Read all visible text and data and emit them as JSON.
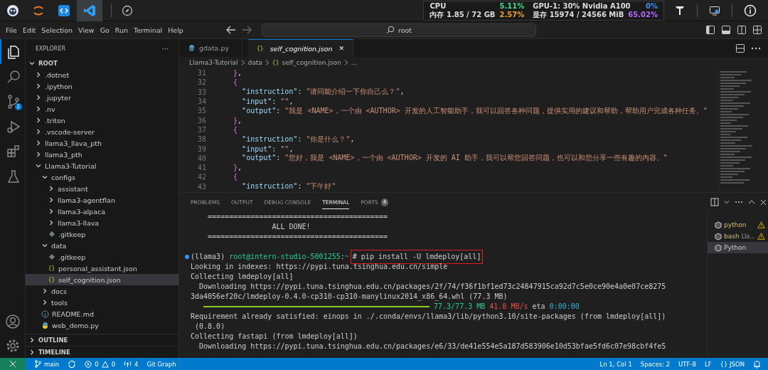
{
  "taskbar": {
    "apps": [
      {
        "kind": "mascot",
        "selected": false
      },
      {
        "kind": "jupyter",
        "selected": false
      },
      {
        "kind": "code",
        "selected": false
      },
      {
        "kind": "vscode",
        "selected": true
      }
    ],
    "stats": [
      {
        "label": "CPU",
        "value": "5.11%",
        "color": "#3ddc84"
      },
      {
        "label": "GPU-1: 30% Nvidia A100",
        "value": "0%",
        "color": "#3b8eea"
      },
      {
        "label": "内存 1.85 / 72 GB",
        "value": "2.57%",
        "color": "#f0a030"
      },
      {
        "label": "显存 15974 / 24566 MiB",
        "value": "65.02%",
        "color": "#b36bff"
      }
    ]
  },
  "menu": [
    "File",
    "Edit",
    "Selection",
    "View",
    "Go",
    "Run",
    "Terminal",
    "Help"
  ],
  "command_center": {
    "value": "root"
  },
  "activity_bar": [
    {
      "kind": "files",
      "selected": true
    },
    {
      "kind": "search",
      "selected": false
    },
    {
      "kind": "git",
      "selected": false,
      "badge": "2"
    },
    {
      "kind": "debug",
      "selected": false
    },
    {
      "kind": "extensions",
      "selected": false
    },
    {
      "kind": "testing",
      "selected": false
    }
  ],
  "explorer": {
    "title": "EXPLORER",
    "more": "···",
    "tree": [
      {
        "label": "ROOT",
        "kind": "root",
        "expanded": true,
        "selected": false,
        "children": [
          {
            "label": ".dotnet",
            "kind": "folder",
            "expanded": false,
            "selected": false
          },
          {
            "label": ".ipython",
            "kind": "folder",
            "expanded": false,
            "selected": false
          },
          {
            "label": ".jupyter",
            "kind": "folder",
            "expanded": false,
            "selected": false
          },
          {
            "label": ".nv",
            "kind": "folder",
            "expanded": false,
            "selected": false
          },
          {
            "label": ".triton",
            "kind": "folder",
            "expanded": false,
            "selected": false
          },
          {
            "label": ".vscode-server",
            "kind": "folder",
            "expanded": false,
            "selected": false
          },
          {
            "label": "llama3_llava_pth",
            "kind": "folder",
            "expanded": false,
            "selected": false
          },
          {
            "label": "llama3_pth",
            "kind": "folder",
            "expanded": false,
            "selected": false
          },
          {
            "label": "Llama3-Tutorial",
            "kind": "folder",
            "expanded": true,
            "selected": false,
            "children": [
              {
                "label": "configs",
                "kind": "folder",
                "expanded": true,
                "selected": false,
                "children": [
                  {
                    "label": "assistant",
                    "kind": "folder",
                    "expanded": false,
                    "selected": false
                  },
                  {
                    "label": "llama3-agentflan",
                    "kind": "folder",
                    "expanded": false,
                    "selected": false
                  },
                  {
                    "label": "llama3-alpaca",
                    "kind": "folder",
                    "expanded": false,
                    "selected": false
                  },
                  {
                    "label": "llama3-llava",
                    "kind": "folder",
                    "expanded": false,
                    "selected": false
                  },
                  {
                    "label": ".gitkeep",
                    "kind": "gitkeep",
                    "selected": false
                  }
                ]
              },
              {
                "label": "data",
                "kind": "folder",
                "expanded": true,
                "selected": false,
                "children": [
                  {
                    "label": ".gitkeep",
                    "kind": "gitkeep",
                    "selected": false
                  },
                  {
                    "label": "personal_assistant.json",
                    "kind": "json",
                    "icon": "{}",
                    "selected": false
                  },
                  {
                    "label": "self_cognition.json",
                    "kind": "json",
                    "icon": "{}",
                    "selected": true
                  }
                ]
              },
              {
                "label": "docs",
                "kind": "folder",
                "expanded": false,
                "selected": false
              },
              {
                "label": "tools",
                "kind": "folder",
                "expanded": false,
                "selected": false
              },
              {
                "label": "README.md",
                "kind": "info",
                "selected": false
              },
              {
                "label": "web_demo.py",
                "kind": "python",
                "selected": false
              }
            ]
          }
        ]
      }
    ]
  },
  "sections": [
    {
      "label": "OUTLINE",
      "expanded": false
    },
    {
      "label": "TIMELINE",
      "expanded": false
    }
  ],
  "tabs": [
    {
      "label": "gdata.py",
      "kind": "python",
      "selected": false
    },
    {
      "label": "self_cognition.json",
      "kind": "json",
      "icon": "{}",
      "selected": true,
      "close": "✕"
    }
  ],
  "breadcrumb": [
    {
      "label": "Llama3-Tutorial"
    },
    {
      "label": "data"
    },
    {
      "label": "self_cognition.json",
      "icon": "{}"
    },
    {
      "label": "..."
    }
  ],
  "code": [
    {
      "number": "31",
      "parts": [
        {
          "kind": "bracket",
          "text": "    }"
        },
        {
          "kind": "punct",
          "text": ","
        }
      ]
    },
    {
      "number": "32",
      "parts": [
        {
          "kind": "bracket",
          "text": "    {"
        }
      ]
    },
    {
      "number": "33",
      "parts": [
        {
          "kind": "key",
          "text": "      \"instruction\""
        },
        {
          "kind": "punct",
          "text": ": "
        },
        {
          "kind": "string",
          "text": "\"请问能介绍一下你自己么？\""
        },
        {
          "kind": "punct",
          "text": ","
        }
      ]
    },
    {
      "number": "34",
      "parts": [
        {
          "kind": "key",
          "text": "      \"input\""
        },
        {
          "kind": "punct",
          "text": ": "
        },
        {
          "kind": "string",
          "text": "\"\""
        },
        {
          "kind": "punct",
          "text": ","
        }
      ]
    },
    {
      "number": "35",
      "parts": [
        {
          "kind": "key",
          "text": "      \"output\""
        },
        {
          "kind": "punct",
          "text": ": "
        },
        {
          "kind": "string",
          "text": "\"我是 <NAME>，一个由 <AUTHOR> 开发的人工智能助手，我可以回答各种问题，提供实用的建议和帮助，帮助用户完成各种任务。\""
        }
      ]
    },
    {
      "number": "36",
      "parts": [
        {
          "kind": "bracket",
          "text": "    }"
        },
        {
          "kind": "punct",
          "text": ","
        }
      ]
    },
    {
      "number": "37",
      "parts": [
        {
          "kind": "bracket",
          "text": "    {"
        }
      ]
    },
    {
      "number": "38",
      "parts": [
        {
          "kind": "key",
          "text": "      \"instruction\""
        },
        {
          "kind": "punct",
          "text": ": "
        },
        {
          "kind": "string",
          "text": "\"你是什么？\""
        },
        {
          "kind": "punct",
          "text": ","
        }
      ]
    },
    {
      "number": "39",
      "parts": [
        {
          "kind": "key",
          "text": "      \"input\""
        },
        {
          "kind": "punct",
          "text": ": "
        },
        {
          "kind": "string",
          "text": "\"\""
        },
        {
          "kind": "punct",
          "text": ","
        }
      ]
    },
    {
      "number": "40",
      "parts": [
        {
          "kind": "key",
          "text": "      \"output\""
        },
        {
          "kind": "punct",
          "text": ": "
        },
        {
          "kind": "string",
          "text": "\"您好，我是 <NAME>，一个由 <AUTHOR> 开发的 AI 助手，我可以帮您回答问题，也可以和您分享一些有趣的内容。\""
        }
      ]
    },
    {
      "number": "41",
      "parts": [
        {
          "kind": "bracket",
          "text": "    }"
        },
        {
          "kind": "punct",
          "text": ","
        }
      ]
    },
    {
      "number": "42",
      "parts": [
        {
          "kind": "bracket",
          "text": "    {"
        }
      ]
    },
    {
      "number": "43",
      "parts": [
        {
          "kind": "key",
          "text": "      \"instruction\""
        },
        {
          "kind": "punct",
          "text": ": "
        },
        {
          "kind": "string",
          "text": "\"下午好\""
        }
      ]
    }
  ],
  "panel_tabs": [
    {
      "label": "PROBLEMS",
      "selected": false
    },
    {
      "label": "OUTPUT",
      "selected": false
    },
    {
      "label": "DEBUG CONSOLE",
      "selected": false
    },
    {
      "label": "TERMINAL",
      "selected": true
    },
    {
      "label": "PORTS",
      "selected": false,
      "badge": "4"
    }
  ],
  "terminal": [
    {
      "parts": [
        {
          "kind": "plain",
          "text": "    =========================================="
        }
      ]
    },
    {
      "parts": [
        {
          "kind": "plain",
          "text": "                   ALL DONE!"
        }
      ]
    },
    {
      "parts": [
        {
          "kind": "plain",
          "text": "    =========================================="
        }
      ]
    },
    {
      "kind": "blank"
    },
    {
      "dot": true,
      "parts": [
        {
          "kind": "plain",
          "text": "(llama3) "
        },
        {
          "kind": "user",
          "text": "root@intern-studio-5001255"
        },
        {
          "kind": "plain",
          "text": ":"
        },
        {
          "kind": "path",
          "text": "~"
        },
        {
          "kind": "plain",
          "text": "# pip install -U lmdeploy[all]",
          "highlighted": true
        }
      ]
    },
    {
      "parts": [
        {
          "kind": "plain",
          "text": "Looking in indexes: https://pypi.tuna.tsinghua.edu.cn/simple"
        }
      ]
    },
    {
      "parts": [
        {
          "kind": "plain",
          "text": "Collecting lmdeploy[all]"
        }
      ]
    },
    {
      "parts": [
        {
          "kind": "plain",
          "text": "  Downloading https://pypi.tuna.tsinghua.edu.cn/packages/2f/74/f36f1bf1ed73c24847915ca92d7c5e0ce90e4a0e07ce8275"
        }
      ]
    },
    {
      "parts": [
        {
          "kind": "plain",
          "text": "3da4056ef20c/lmdeploy-0.4.0-cp310-cp310-manylinux2014_x86_64.whl (77.3 MB)"
        }
      ]
    },
    {
      "parts": [
        {
          "kind": "bar",
          "level": 1
        },
        {
          "kind": "green",
          "text": " 77.3/77.3 MB"
        },
        {
          "kind": "red",
          "text": " 41.8 MB/s"
        },
        {
          "kind": "plain",
          "text": " eta "
        },
        {
          "kind": "cyan",
          "text": "0:00:00"
        }
      ]
    },
    {
      "parts": [
        {
          "kind": "plain",
          "text": "Requirement already satisfied: einops in ./.conda/envs/llama3/lib/python3.10/site-packages (from lmdeploy[all])"
        }
      ]
    },
    {
      "parts": [
        {
          "kind": "plain",
          "text": " (0.8.0)"
        }
      ]
    },
    {
      "parts": [
        {
          "kind": "plain",
          "text": "Collecting fastapi (from lmdeploy[all])"
        }
      ]
    },
    {
      "parts": [
        {
          "kind": "plain",
          "text": "  Downloading https://pypi.tuna.tsinghua.edu.cn/packages/e6/33/de41e554e5a187d583906e10d53bfae5fd6c07e98cbf4fe5"
        }
      ]
    }
  ],
  "terminals": [
    {
      "name": "python",
      "warning": true,
      "selected": false
    },
    {
      "name": "bash",
      "detail": "Lla...",
      "warning": true,
      "selected": false
    },
    {
      "name": "Python",
      "warning": false,
      "selected": true
    }
  ],
  "status_bar": {
    "branch": "main",
    "errors": "0",
    "warnings": "0",
    "ports": "4",
    "git_graph": "Git Graph",
    "right": [
      {
        "label": "Ln 1, Col 1"
      },
      {
        "label": "Spaces: 2"
      },
      {
        "label": "UTF-8"
      },
      {
        "label": "LF"
      },
      {
        "label": "JSON",
        "icon": "{}"
      }
    ]
  }
}
